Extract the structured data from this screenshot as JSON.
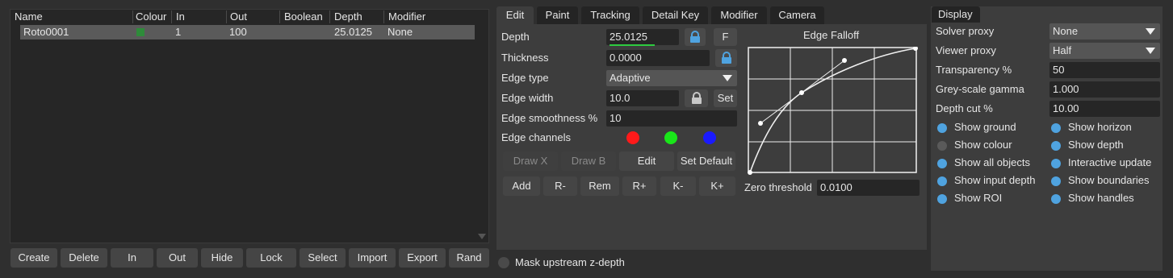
{
  "layer_list": {
    "columns": [
      "Name",
      "Colour",
      "In",
      "Out",
      "Boolean",
      "Depth",
      "Modifier"
    ],
    "rows": [
      {
        "name": "Roto0001",
        "colour": "#2e8b3a",
        "in": "1",
        "out": "100",
        "boolean": "",
        "depth": "25.0125",
        "modifier": "None"
      }
    ]
  },
  "layer_buttons": [
    "Create",
    "Delete",
    "In",
    "Out",
    "Hide",
    "Lock",
    "Select",
    "Import",
    "Export",
    "Rand"
  ],
  "tabs": [
    "Edit",
    "Paint",
    "Tracking",
    "Detail Key",
    "Modifier",
    "Camera"
  ],
  "edit": {
    "depth_label": "Depth",
    "depth_value": "25.0125",
    "f_label": "F",
    "thickness_label": "Thickness",
    "thickness_value": "0.0000",
    "edge_type_label": "Edge type",
    "edge_type_value": "Adaptive",
    "edge_width_label": "Edge width",
    "edge_width_value": "10.0",
    "set_label": "Set",
    "edge_smoothness_label": "Edge smoothness %",
    "edge_smoothness_value": "10",
    "edge_channels_label": "Edge channels",
    "channel_colors": [
      "#ff1a1a",
      "#19e619",
      "#1a1aff"
    ],
    "draw_x": "Draw X",
    "draw_b": "Draw B",
    "edit_btn": "Edit",
    "set_default": "Set Default",
    "action_buttons": [
      "Add",
      "R-",
      "Rem",
      "R+",
      "K-",
      "K+"
    ]
  },
  "falloff": {
    "title": "Edge Falloff",
    "zero_threshold_label": "Zero threshold",
    "zero_threshold_value": "0.0100"
  },
  "mask_label": "Mask upstream z-depth",
  "display": {
    "title": "Display",
    "solver_proxy_label": "Solver proxy",
    "solver_proxy_value": "None",
    "viewer_proxy_label": "Viewer proxy",
    "viewer_proxy_value": "Half",
    "transparency_label": "Transparency %",
    "transparency_value": "50",
    "gamma_label": "Grey-scale gamma",
    "gamma_value": "1.000",
    "depth_cut_label": "Depth cut %",
    "depth_cut_value": "10.00",
    "options": [
      {
        "label": "Show ground",
        "on": true
      },
      {
        "label": "Show horizon",
        "on": true
      },
      {
        "label": "Show colour",
        "on": false
      },
      {
        "label": "Show depth",
        "on": true
      },
      {
        "label": "Show all objects",
        "on": true
      },
      {
        "label": "Interactive update",
        "on": true
      },
      {
        "label": "Show input depth",
        "on": true
      },
      {
        "label": "Show boundaries",
        "on": true
      },
      {
        "label": "Show ROI",
        "on": true
      },
      {
        "label": "Show handles",
        "on": true
      }
    ],
    "radio_on_color": "#4fa3e0",
    "radio_off_color": "#5a5a5a"
  }
}
